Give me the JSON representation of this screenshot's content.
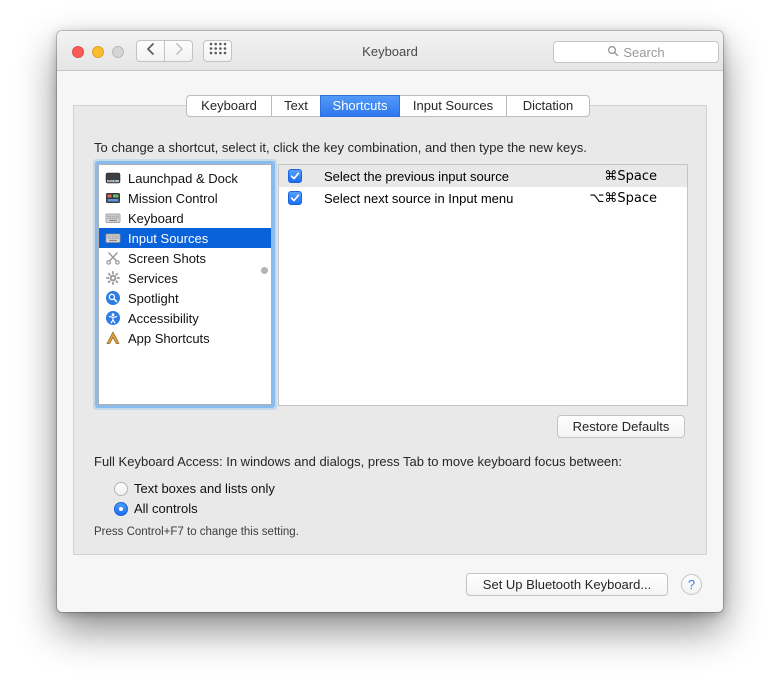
{
  "window": {
    "title": "Keyboard"
  },
  "toolbar": {
    "search_placeholder": "Search",
    "back_icon": "chevron-left",
    "forward_icon": "chevron-right",
    "show_all_icon": "grid-of-dots"
  },
  "tabs": [
    {
      "label": "Keyboard",
      "selected": false
    },
    {
      "label": "Text",
      "selected": false
    },
    {
      "label": "Shortcuts",
      "selected": true
    },
    {
      "label": "Input Sources",
      "selected": false
    },
    {
      "label": "Dictation",
      "selected": false
    }
  ],
  "instruction": "To change a shortcut, select it, click the key combination, and then type the new keys.",
  "sidebar": {
    "items": [
      {
        "label": "Launchpad & Dock",
        "icon": "dock-icon",
        "selected": false
      },
      {
        "label": "Mission Control",
        "icon": "mission-control-icon",
        "selected": false
      },
      {
        "label": "Keyboard",
        "icon": "keyboard-icon",
        "selected": false
      },
      {
        "label": "Input Sources",
        "icon": "keyboard-icon",
        "selected": true
      },
      {
        "label": "Screen Shots",
        "icon": "scissors-icon",
        "selected": false
      },
      {
        "label": "Services",
        "icon": "gear-icon",
        "selected": false
      },
      {
        "label": "Spotlight",
        "icon": "magnifier-badge-icon",
        "selected": false
      },
      {
        "label": "Accessibility",
        "icon": "accessibility-icon",
        "selected": false
      },
      {
        "label": "App Shortcuts",
        "icon": "app-shortcuts-icon",
        "selected": false
      }
    ]
  },
  "shortcuts": [
    {
      "checked": true,
      "label": "Select the previous input source",
      "keys": "⌘Space"
    },
    {
      "checked": true,
      "label": "Select next source in Input menu",
      "keys": "⌥⌘Space"
    }
  ],
  "buttons": {
    "restore_defaults": "Restore Defaults",
    "setup_bluetooth": "Set Up Bluetooth Keyboard...",
    "help": "?"
  },
  "full_keyboard_access": {
    "heading": "Full Keyboard Access: In windows and dialogs, press Tab to move keyboard focus between:",
    "options": [
      {
        "label": "Text boxes and lists only",
        "selected": false
      },
      {
        "label": "All controls",
        "selected": true
      }
    ],
    "note": "Press Control+F7 to change this setting."
  },
  "colors": {
    "selection_blue": "#0a62da",
    "tab_blue": "#3b82f4",
    "checkbox_blue": "#2e7cf4",
    "focus_ring": "#86baed",
    "panel_gray": "#e9e9e9",
    "titlebar_gray": "#ececec"
  }
}
